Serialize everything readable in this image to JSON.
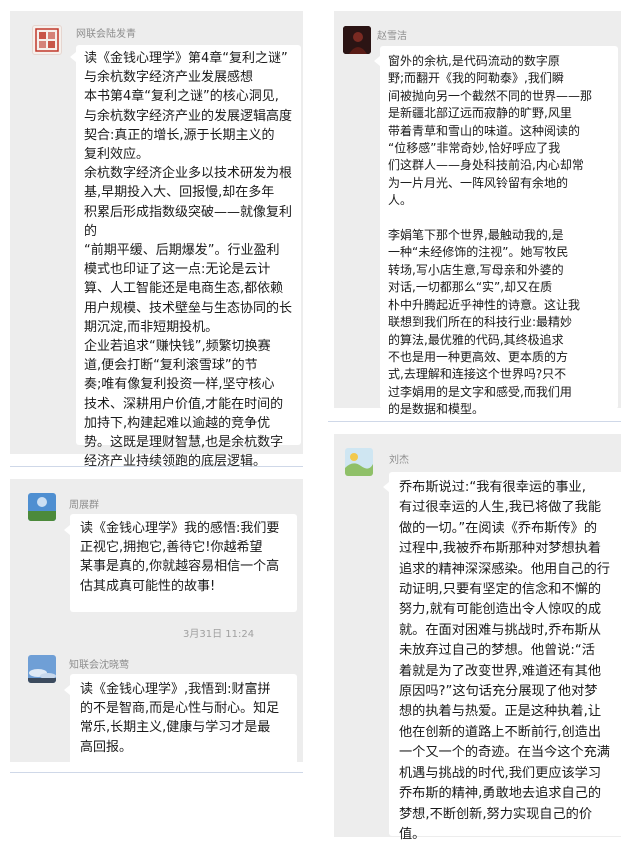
{
  "colors": {
    "panel_bg": "#ededed",
    "bubble_bg": "#ffffff",
    "divider": "#cfd8e8",
    "name_text": "#8e8e8e",
    "body_text": "#1a1a1a"
  },
  "messages": [
    {
      "sender": "网联会陆发青",
      "avatar_icon": "red-seal-avatar-icon",
      "text": "读《金钱心理学》第4章“复利之谜”\n与余杭数字经济产业发展感想\n本书第4章“复利之谜”的核心洞见,\n与余杭数字经济产业的发展逻辑高度\n契合:真正的增长,源于长期主义的\n复利效应。\n余杭数字经济企业多以技术研发为根\n基,早期投入大、回报慢,却在多年\n积累后形成指数级突破——就像复利的\n“前期平缓、后期爆发”。行业盈利\n模式也印证了这一点:无论是云计\n算、人工智能还是电商生态,都依赖\n用户规模、技术壁垒与生态协同的长\n期沉淀,而非短期投机。\n企业若追求“赚快钱”,频繁切换赛\n道,便会打断“复利滚雪球”的节\n奏;唯有像复利投资一样,坚守核心\n技术、深耕用户价值,才能在时间的\n加持下,构建起难以逾越的竞争优\n势。这既是理财智慧,也是余杭数字\n经济产业持续领跑的底层逻辑。"
    },
    {
      "sender": "赵雪洁",
      "avatar_icon": "dark-portrait-avatar-icon",
      "text": "窗外的余杭,是代码流动的数字原\n野;而翻开《我的阿勒泰》,我们瞬\n间被抛向另一个截然不同的世界——那\n是新疆北部辽远而寂静的旷野,风里\n带着青草和雪山的味道。这种阅读的\n“位移感”非常奇妙,恰好呼应了我\n们这群人——身处科技前沿,内心却常\n为一片月光、一阵风铃留有余地的\n人。\n\n李娟笔下那个世界,最触动我的,是\n一种“未经修饰的注视”。她写牧民\n转场,写小店生意,写母亲和外婆的\n对话,一切都那么“实”,却又在质\n朴中升腾起近乎神性的诗意。这让我\n联想到我们所在的科技行业:最精妙\n的算法,最优雅的代码,其终极追求\n不也是用一种更高效、更本质的方\n式,去理解和连接这个世界吗?只不\n过李娟用的是文字和感受,而我们用\n的是数据和模型。"
    },
    {
      "sender": "周展群",
      "avatar_icon": "sky-landscape-avatar-icon",
      "text": "读《金钱心理学》我的感悟:我们要\n正视它,拥抱它,善待它!你越希望\n某事是真的,你就越容易相信一个高\n估其成真可能性的故事!"
    },
    {
      "sender": "刘杰",
      "avatar_icon": "cartoon-landscape-avatar-icon",
      "text": "乔布斯说过:“我有很幸运的事业,\n有过很幸运的人生,我已将做了我能\n做的一切。”在阅读《乔布斯传》的\n过程中,我被乔布斯那种对梦想执着\n追求的精神深深感染。他用自己的行\n动证明,只要有坚定的信念和不懈的\n努力,就有可能创造出令人惊叹的成\n就。在面对困难与挑战时,乔布斯从\n未放弃过自己的梦想。他曾说:“活\n着就是为了改变世界,难道还有其他\n原因吗?”这句话充分展现了他对梦\n想的执着与热爱。正是这种执着,让\n他在创新的道路上不断前行,创造出\n一个又一个的奇迹。在当今这个充满\n机遇与挑战的时代,我们更应该学习\n乔布斯的精神,勇敢地去追求自己的\n梦想,不断创新,努力实现自己的价\n值。"
    },
    {
      "timestamp": "3月31日 11:24",
      "sender": "知联会沈晓莺",
      "avatar_icon": "sky-cloud-avatar-icon",
      "text": "读《金钱心理学》,我悟到:财富拼\n的不是智商,而是心性与耐心。知足\n常乐,长期主义,健康与学习才是最\n高回报。"
    }
  ]
}
